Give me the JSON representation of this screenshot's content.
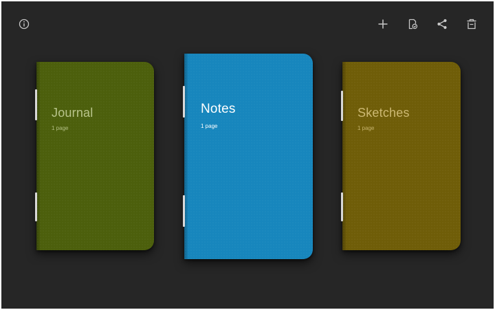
{
  "toolbar": {
    "info_icon": "info-circle",
    "add_icon": "plus",
    "export_icon": "document-export",
    "share_icon": "share",
    "delete_icon": "trash"
  },
  "colors": {
    "background": "#262626",
    "journal": "#4c5f0c",
    "notes": "#1786bd",
    "sketches": "#6f5d08"
  },
  "notebooks": [
    {
      "title": "Journal",
      "count": "1 page",
      "selected": false
    },
    {
      "title": "Notes",
      "count": "1 page",
      "selected": true
    },
    {
      "title": "Sketches",
      "count": "1 page",
      "selected": false
    }
  ]
}
